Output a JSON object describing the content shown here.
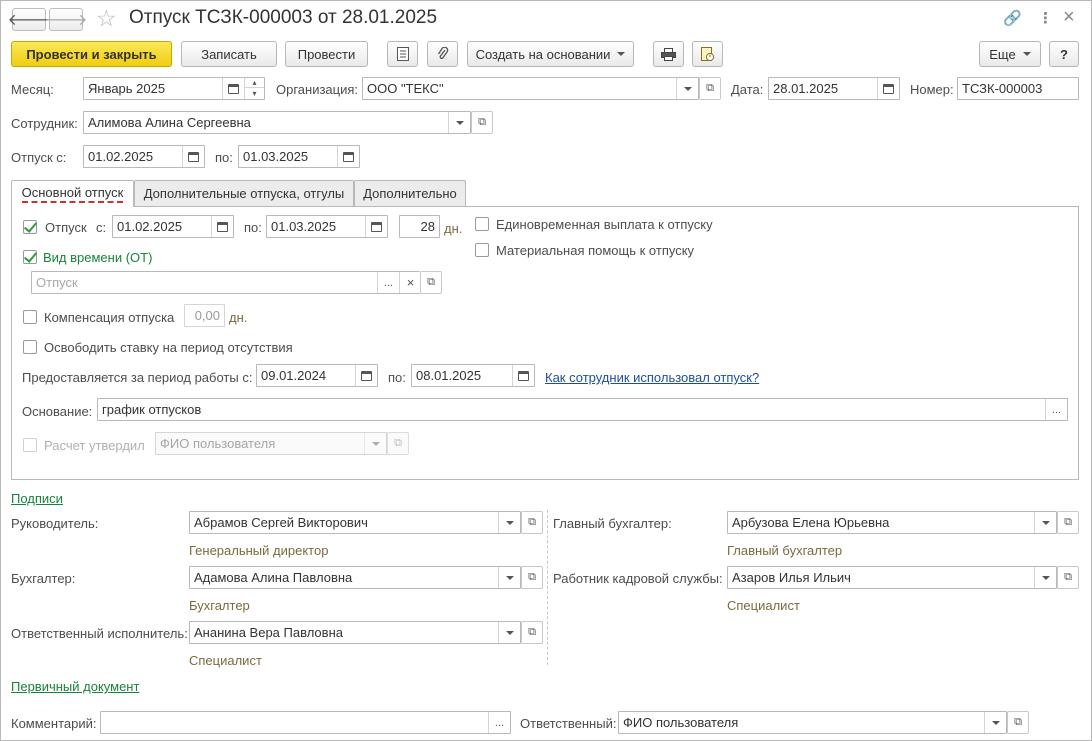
{
  "window": {
    "title": "Отпуск ТСЗК-000003 от 28.01.2025",
    "back_glyph": "🡐",
    "forward_glyph": "🡒",
    "star_glyph": "☆",
    "link_glyph": "🔗",
    "more_glyph": "⋮",
    "close_glyph": "×"
  },
  "toolbar": {
    "post_close": "Провести и закрыть",
    "save": "Записать",
    "post": "Провести",
    "create_based": "Создать на основании",
    "more": "Еще",
    "help": "?"
  },
  "header": {
    "month_label": "Месяц:",
    "month_value": "Январь 2025",
    "org_label": "Организация:",
    "org_value": "ООО \"ТЕКС\"",
    "date_label": "Дата:",
    "date_value": "28.01.2025",
    "number_label": "Номер:",
    "number_value": "ТСЗК-000003",
    "employee_label": "Сотрудник:",
    "employee_value": "Алимова Алина Сергеевна",
    "leave_from_label": "Отпуск с:",
    "leave_from_value": "01.02.2025",
    "leave_to_label": "по:",
    "leave_to_value": "01.03.2025"
  },
  "tabs": [
    {
      "label": "Основной отпуск"
    },
    {
      "label": "Дополнительные отпуска, отгулы"
    },
    {
      "label": "Дополнительно"
    }
  ],
  "main_tab": {
    "leave_label": "Отпуск",
    "from_label": "с:",
    "from_value": "01.02.2025",
    "to_label": "по:",
    "to_value": "01.03.2025",
    "days_value": "28",
    "days_unit": "дн.",
    "lump_sum_label": "Единовременная выплата к отпуску",
    "material_aid_label": "Материальная помощь к отпуску",
    "time_type_label": "Вид времени (ОТ)",
    "time_type_placeholder": "Отпуск",
    "compensation_label": "Компенсация отпуска",
    "compensation_value": "0,00",
    "compensation_unit": "дн.",
    "free_rate_label": "Освободить ставку на период отсутствия",
    "period_label": "Предоставляется за период работы с:",
    "period_from": "09.01.2024",
    "period_to_label": "по:",
    "period_to": "08.01.2025",
    "how_used_link": "Как сотрудник использовал отпуск?",
    "basis_label": "Основание:",
    "basis_value": "график отпусков",
    "approved_label": "Расчет утвердил",
    "approved_placeholder": "ФИО пользователя"
  },
  "signatures": {
    "section_link": "Подписи",
    "manager_label": "Руководитель:",
    "manager_value": "Абрамов Сергей Викторович",
    "manager_position": "Генеральный директор",
    "accountant_label": "Бухгалтер:",
    "accountant_value": "Адамова Алина Павловна",
    "accountant_position": "Бухгалтер",
    "executor_label": "Ответственный исполнитель:",
    "executor_value": "Ананина Вера Павловна",
    "executor_position": "Специалист",
    "chief_label": "Главный бухгалтер:",
    "chief_value": "Арбузова Елена Юрьевна",
    "chief_position": "Главный бухгалтер",
    "hr_label": "Работник кадровой службы:",
    "hr_value": "Азаров Илья Ильич",
    "hr_position": "Специалист"
  },
  "footer": {
    "primary_doc_link": "Первичный документ",
    "comment_label": "Комментарий:",
    "comment_value": "",
    "responsible_label": "Ответственный:",
    "responsible_value": "ФИО пользователя"
  },
  "glyphs": {
    "dots": "...",
    "open": "⧉",
    "clear": "×",
    "spin_up": "▴",
    "spin_down": "▾"
  }
}
